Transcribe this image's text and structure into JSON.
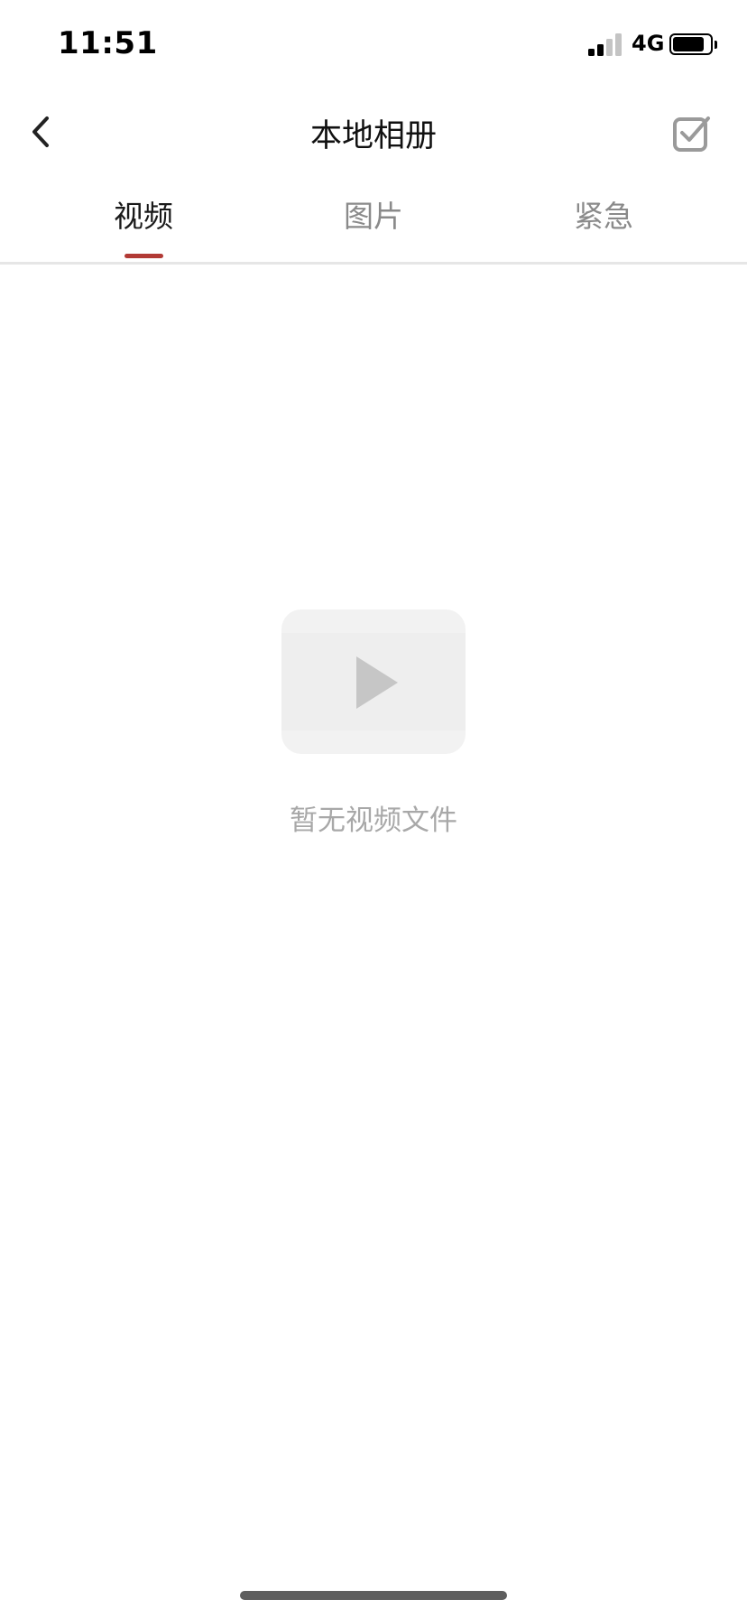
{
  "status_bar": {
    "time": "11:51",
    "network": "4G",
    "signal_bars_active": 2,
    "signal_bars_total": 4,
    "battery_level": 0.85
  },
  "nav": {
    "title": "本地相册",
    "back_icon": "chevron-left-icon",
    "select_icon": "checkbox-icon"
  },
  "tabs": [
    {
      "label": "视频",
      "active": true
    },
    {
      "label": "图片",
      "active": false
    },
    {
      "label": "紧急",
      "active": false
    }
  ],
  "empty_state": {
    "icon": "video-placeholder-icon",
    "message": "暂无视频文件"
  },
  "colors": {
    "accent": "#b23a35",
    "inactive_text": "#8a8a8a",
    "icon_gray": "#9a9a9a",
    "signal_inactive": "#c4c4c4"
  }
}
